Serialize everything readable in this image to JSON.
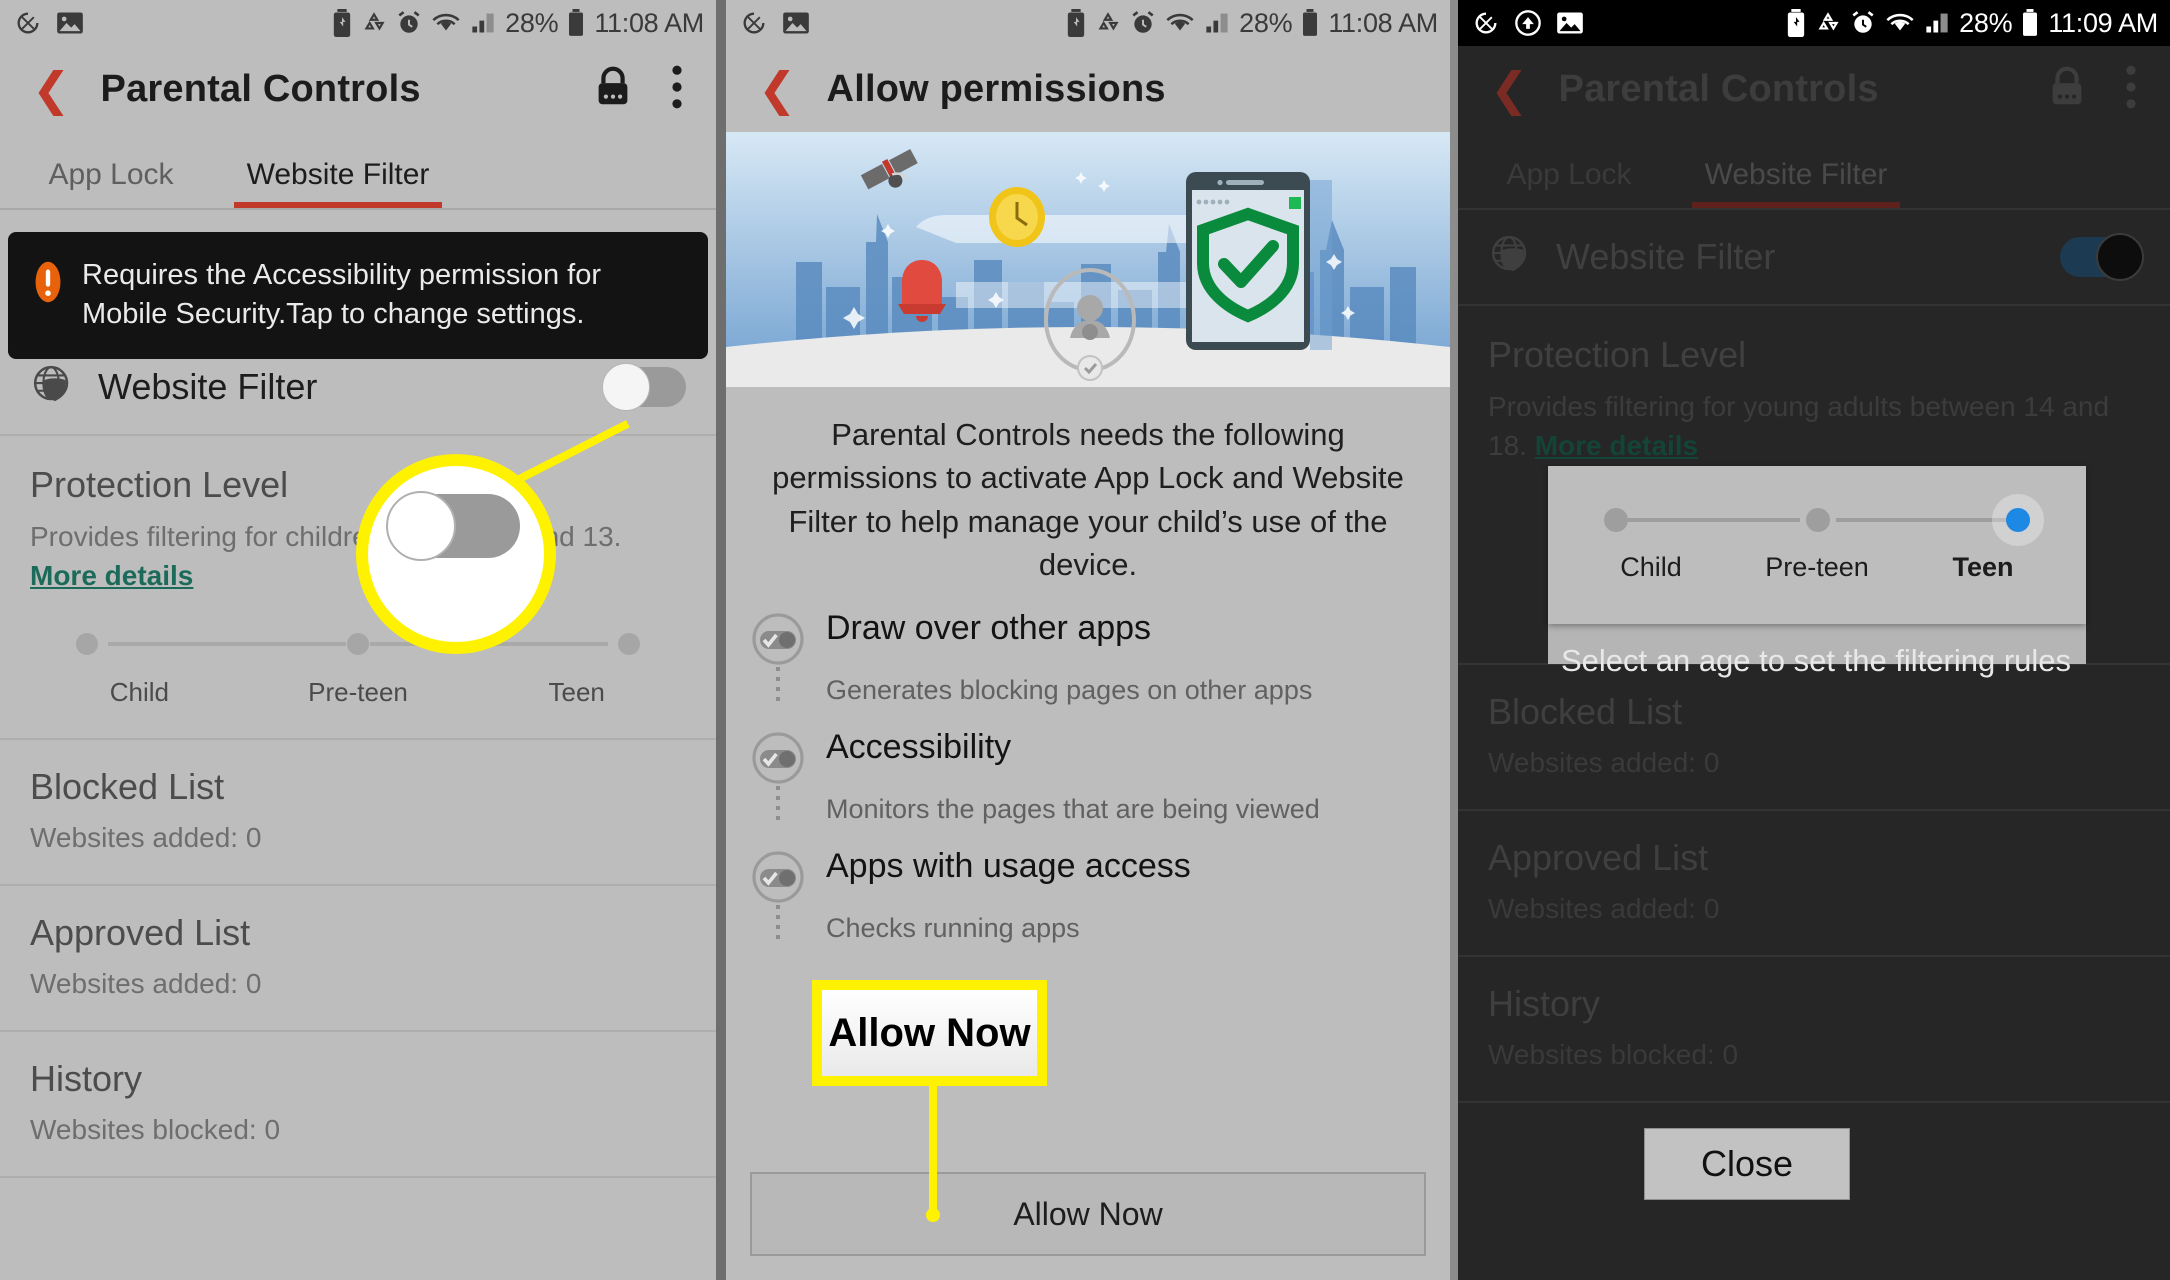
{
  "panels": {
    "left": {
      "status": {
        "time": "11:08 AM",
        "battery": "28%",
        "icons": [
          "screen-rotate-icon",
          "photo-icon",
          "battery-saver-icon",
          "data-saver-icon",
          "alarm-icon",
          "wifi-icon",
          "signal-icon",
          "battery-icon"
        ]
      },
      "appbar": {
        "back": "back-arrow-icon",
        "title": "Parental Controls",
        "lock_icon": "lock-icon",
        "overflow_icon": "more-vert-icon"
      },
      "tabs": [
        {
          "label": "App Lock",
          "active": false
        },
        {
          "label": "Website Filter",
          "active": true
        }
      ],
      "toast": {
        "icon": "alert-icon",
        "text": "Requires the Accessibility permission for Mobile Security.Tap to change settings."
      },
      "website_filter": {
        "icon": "globe-shield-icon",
        "label": "Website Filter",
        "toggle_on": false
      },
      "protection": {
        "title": "Protection Level",
        "description_before": "Provides filtering for children",
        "description_after": "and 13. ",
        "description_full": "Provides filtering for children between 7 and 13. ",
        "link": "More details",
        "levels": [
          "Child",
          "Pre-teen",
          "Teen"
        ],
        "selected_index": null
      },
      "items": [
        {
          "title": "Blocked List",
          "sub": "Websites added: 0"
        },
        {
          "title": "Approved List",
          "sub": "Websites added: 0"
        },
        {
          "title": "History",
          "sub": "Websites blocked: 0"
        }
      ],
      "callout": {
        "type": "circle-zoom",
        "target": "website-filter-toggle",
        "color": "#FFF200"
      }
    },
    "middle": {
      "status": {
        "time": "11:08 AM",
        "battery": "28%"
      },
      "appbar": {
        "back": "back-arrow-icon",
        "title": "Allow permissions"
      },
      "hero": {
        "alt_items": [
          "satellite-icon",
          "clock-icon",
          "bell-icon",
          "city-skyline",
          "phone-shield-illustration",
          "user-avatar-badge"
        ]
      },
      "intro": "Parental Controls needs the following permissions to activate App Lock and Website Filter to help manage your child’s use of the device.",
      "permissions": [
        {
          "icon": "toggle-check-icon",
          "title": "Draw over other apps",
          "desc": "Generates blocking pages on other apps"
        },
        {
          "icon": "toggle-check-icon",
          "title": "Accessibility",
          "desc": "Monitors the pages that are being viewed"
        },
        {
          "icon": "toggle-check-icon",
          "title": "Apps with usage access",
          "desc": "Checks running apps"
        }
      ],
      "allow_button": "Allow Now",
      "callout": {
        "type": "label-box",
        "label": "Allow Now",
        "color": "#FFF200"
      }
    },
    "right": {
      "status": {
        "time": "11:09 AM",
        "battery": "28%",
        "icons": [
          "screen-rotate-icon",
          "upload-cloud-icon",
          "photo-icon",
          "battery-saver-icon",
          "data-saver-icon",
          "alarm-icon",
          "wifi-icon",
          "signal-icon",
          "battery-icon"
        ]
      },
      "appbar": {
        "back": "back-arrow-icon",
        "title": "Parental Controls",
        "lock_icon": "lock-icon",
        "overflow_icon": "more-vert-icon"
      },
      "tabs": [
        {
          "label": "App Lock",
          "active": false
        },
        {
          "label": "Website Filter",
          "active": true
        }
      ],
      "website_filter": {
        "icon": "globe-shield-icon",
        "label": "Website Filter",
        "toggle_on": true
      },
      "protection": {
        "title": "Protection Level",
        "description": "Provides filtering for young adults between 14 and 18. ",
        "link": "More details"
      },
      "popup": {
        "levels": [
          "Child",
          "Pre-teen",
          "Teen"
        ],
        "selected": "Teen",
        "selected_index": 2,
        "accent": "#1e88e5"
      },
      "hint": "Select an age to set the filtering rules",
      "items": [
        {
          "title": "Blocked List",
          "sub": "Websites added: 0"
        },
        {
          "title": "Approved List",
          "sub": "Websites added: 0"
        },
        {
          "title": "History",
          "sub": "Websites blocked: 0"
        }
      ],
      "close_button": "Close"
    }
  }
}
